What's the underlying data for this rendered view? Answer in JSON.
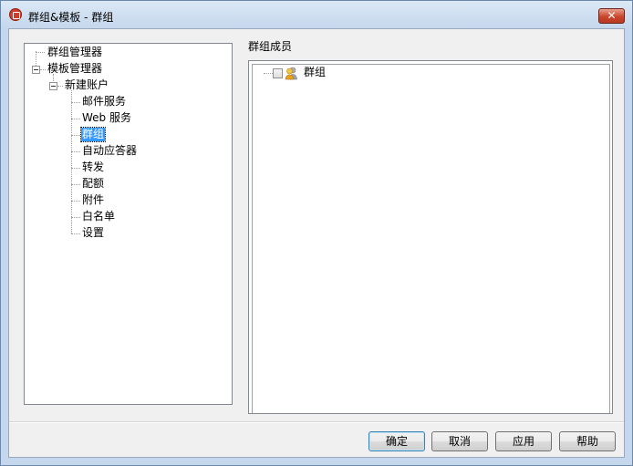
{
  "window": {
    "title": "群组&模板 - 群组",
    "close_label": "✕"
  },
  "tree": {
    "items": [
      {
        "label": "群组管理器"
      },
      {
        "label": "模板管理器"
      },
      {
        "label": "新建账户"
      },
      {
        "label": "邮件服务"
      },
      {
        "label": "Web 服务"
      },
      {
        "label": "群组",
        "selected": true
      },
      {
        "label": "自动应答器"
      },
      {
        "label": "转发"
      },
      {
        "label": "配额"
      },
      {
        "label": "附件"
      },
      {
        "label": "白名单"
      },
      {
        "label": "设置"
      }
    ]
  },
  "members": {
    "heading": "群组成员",
    "items": [
      {
        "label": "群组",
        "checked": false
      }
    ]
  },
  "buttons": {
    "ok": "确定",
    "cancel": "取消",
    "apply": "应用",
    "help": "帮助"
  },
  "colors": {
    "selection": "#3399ff",
    "close_button": "#c8462c",
    "frame": "#c5d7ec"
  }
}
